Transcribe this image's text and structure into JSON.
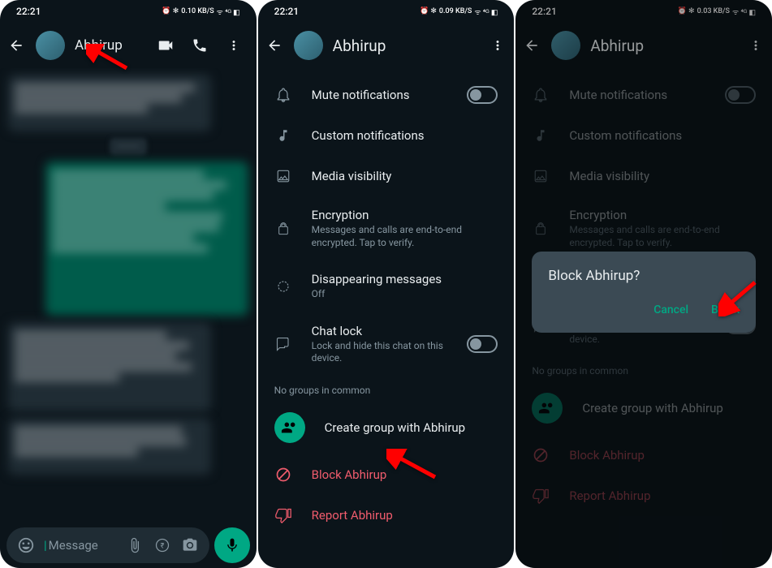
{
  "status": {
    "time": "22:21",
    "icons": "⏰ ⁂ ⇅ ᯤ ⁴ᴳ ₃₀"
  },
  "s1": {
    "data_rate": "0.10 KB/S"
  },
  "s2": {
    "data_rate": "0.09 KB/S"
  },
  "s3": {
    "data_rate": "0.03 KB/S"
  },
  "contact": "Abhirup",
  "input": {
    "placeholder": "Message"
  },
  "settings": {
    "mute": "Mute notifications",
    "custom": "Custom notifications",
    "media": "Media visibility",
    "enc_title": "Encryption",
    "enc_sub": "Messages and calls are end-to-end encrypted. Tap to verify.",
    "disappear_title": "Disappearing messages",
    "disappear_sub": "Off",
    "lock_title": "Chat lock",
    "lock_sub": "Lock and hide this chat on this device.",
    "no_groups": "No groups in common",
    "create_group": "Create group with Abhirup",
    "block": "Block Abhirup",
    "report": "Report Abhirup"
  },
  "dialog": {
    "title": "Block Abhirup?",
    "cancel": "Cancel",
    "block": "Block"
  }
}
